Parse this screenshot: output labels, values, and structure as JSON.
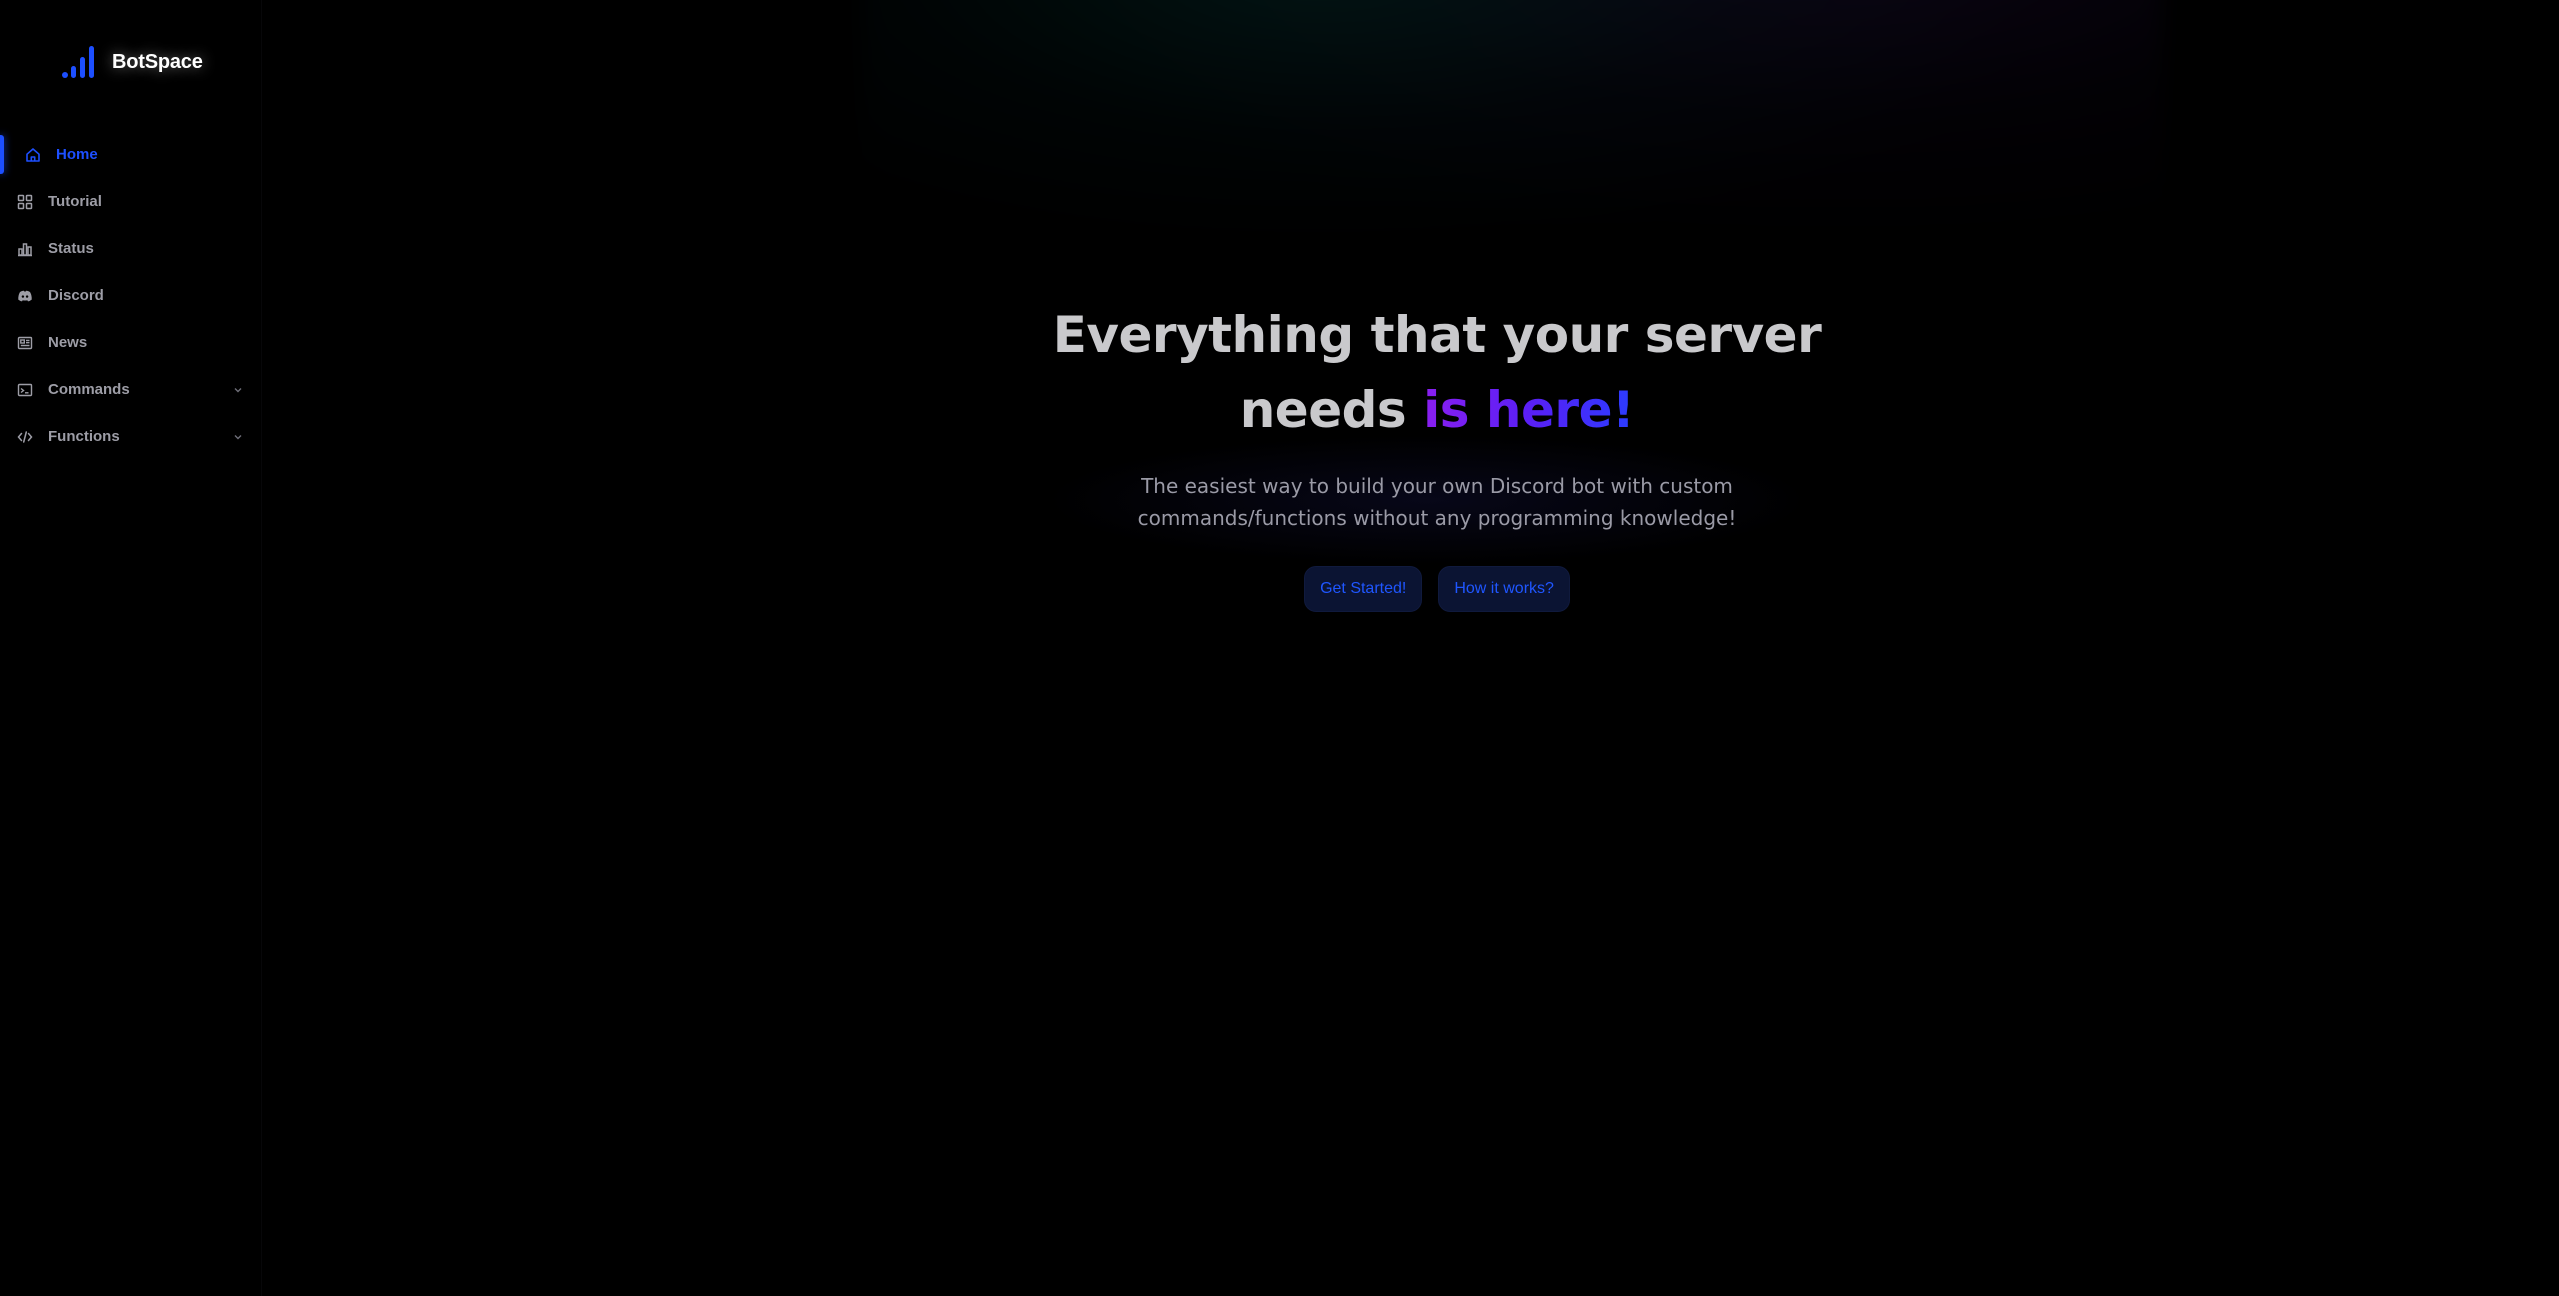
{
  "brand": {
    "name": "BotSpace",
    "logo_icon": "signal-bars-icon",
    "accent_color": "#1d4fff"
  },
  "sidebar": {
    "items": [
      {
        "label": "Home",
        "icon": "home-icon",
        "active": true
      },
      {
        "label": "Tutorial",
        "icon": "grid-icon",
        "active": false
      },
      {
        "label": "Status",
        "icon": "bar-chart-icon",
        "active": false
      },
      {
        "label": "Discord",
        "icon": "discord-icon",
        "active": false
      },
      {
        "label": "News",
        "icon": "newspaper-icon",
        "active": false
      },
      {
        "label": "Commands",
        "icon": "terminal-icon",
        "active": false,
        "expandable": true
      },
      {
        "label": "Functions",
        "icon": "code-icon",
        "active": false,
        "expandable": true
      }
    ]
  },
  "hero": {
    "title_part1": "Everything that your server needs",
    "title_accent": "is here!",
    "subtitle": "The easiest way to build your own Discord bot with custom commands/functions without any programming knowledge!",
    "primary_button": "Get Started!",
    "secondary_button": "How it works?"
  },
  "colors": {
    "background": "#000000",
    "accent": "#1d4fff",
    "title_text": "#c9c9cc",
    "accent_gradient_start": "#8a1ff0",
    "accent_gradient_end": "#2b3cff",
    "button_bg": "#0b1433"
  }
}
